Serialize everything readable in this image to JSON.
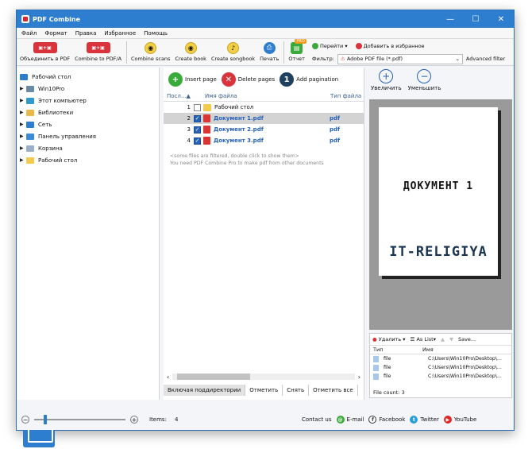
{
  "window": {
    "title": "PDF Combine",
    "min": "—",
    "max": "☐",
    "close": "✕"
  },
  "menu": [
    "Файл",
    "Формат",
    "Правка",
    "Избранное",
    "Помощь"
  ],
  "toolbar": {
    "buttons": [
      {
        "label": "Объединить в PDF",
        "icon": "pdf-merge-icon"
      },
      {
        "label": "Combine to PDF/A",
        "icon": "pdfa-merge-icon"
      },
      {
        "label": "Combine scans",
        "icon": "scans-icon"
      },
      {
        "label": "Create book",
        "icon": "book-icon"
      },
      {
        "label": "Create songbook",
        "icon": "songbook-icon"
      },
      {
        "label": "Печать",
        "icon": "printer-icon"
      },
      {
        "label": "Отчет",
        "icon": "report-icon",
        "badge": "PRO"
      }
    ],
    "goto": "Перейти",
    "favorites": "Добавить в избранное",
    "filter_label": "Фильтр:",
    "filter_value": "Adobe PDF file (*.pdf)",
    "advanced": "Advanced filter"
  },
  "tree": [
    {
      "label": "Рабочий стол",
      "color": "#2e7ed0",
      "root": true
    },
    {
      "label": "Win10Pro",
      "color": "#6a8aa8"
    },
    {
      "label": "Этот компьютер",
      "color": "#2e9ad0"
    },
    {
      "label": "Библиотеки",
      "color": "#e8b848"
    },
    {
      "label": "Сеть",
      "color": "#2e7ed0"
    },
    {
      "label": "Панель управления",
      "color": "#3a8ad8"
    },
    {
      "label": "Корзина",
      "color": "#9ab0c8"
    },
    {
      "label": "Рабочий стол",
      "color": "#f3c94e"
    }
  ],
  "center": {
    "tools": [
      {
        "label": "Insert page",
        "color": "#3aaa3a",
        "glyph": "+"
      },
      {
        "label": "Delete pages",
        "color": "#d9343b",
        "glyph": "✕"
      },
      {
        "label": "Add pagination",
        "color": "#1f3f5f",
        "glyph": "1"
      }
    ],
    "headers": {
      "num": "Посл...▲",
      "name": "Имя файла",
      "type": "Тип файла"
    },
    "rows": [
      {
        "num": "1",
        "name": "Рабочий стол",
        "type": "",
        "checked": false,
        "folder": true
      },
      {
        "num": "2",
        "name": "Документ 1.pdf",
        "type": "pdf",
        "checked": true,
        "folder": false
      },
      {
        "num": "3",
        "name": "Документ 2.pdf",
        "type": "pdf",
        "checked": true,
        "folder": false
      },
      {
        "num": "4",
        "name": "Документ 3.pdf",
        "type": "pdf",
        "checked": true,
        "folder": false
      }
    ],
    "note1": "<some files are filtered, double click to show them>",
    "note2": "You need PDF Combine Pro to make pdf from other documents",
    "bottom_tabs": [
      "Включая поддиректории",
      "Отметить",
      "Снять",
      "Отметить все"
    ]
  },
  "right": {
    "zoom_in": "Увеличить",
    "zoom_out": "Уменьшить",
    "preview_line1": "ДОКУМЕНТ 1",
    "preview_line2": "IT-RELIGIYA",
    "list_delete": "Удалить",
    "list_aslist": "As List",
    "list_save": "Save...",
    "list_hdr_type": "Тип",
    "list_hdr_name": "Имя",
    "files": [
      {
        "type": "file",
        "name": "C:\\Users\\Win10Pro\\Desktop\\..."
      },
      {
        "type": "file",
        "name": "C:\\Users\\Win10Pro\\Desktop\\..."
      },
      {
        "type": "file",
        "name": "C:\\Users\\Win10Pro\\Desktop\\..."
      }
    ],
    "file_count_label": "File count:",
    "file_count": "3"
  },
  "status": {
    "items_label": "Items:",
    "items": "4",
    "contact": "Contact us",
    "email": "E-mail",
    "facebook": "Facebook",
    "twitter": "Twitter",
    "youtube": "YouTube"
  }
}
